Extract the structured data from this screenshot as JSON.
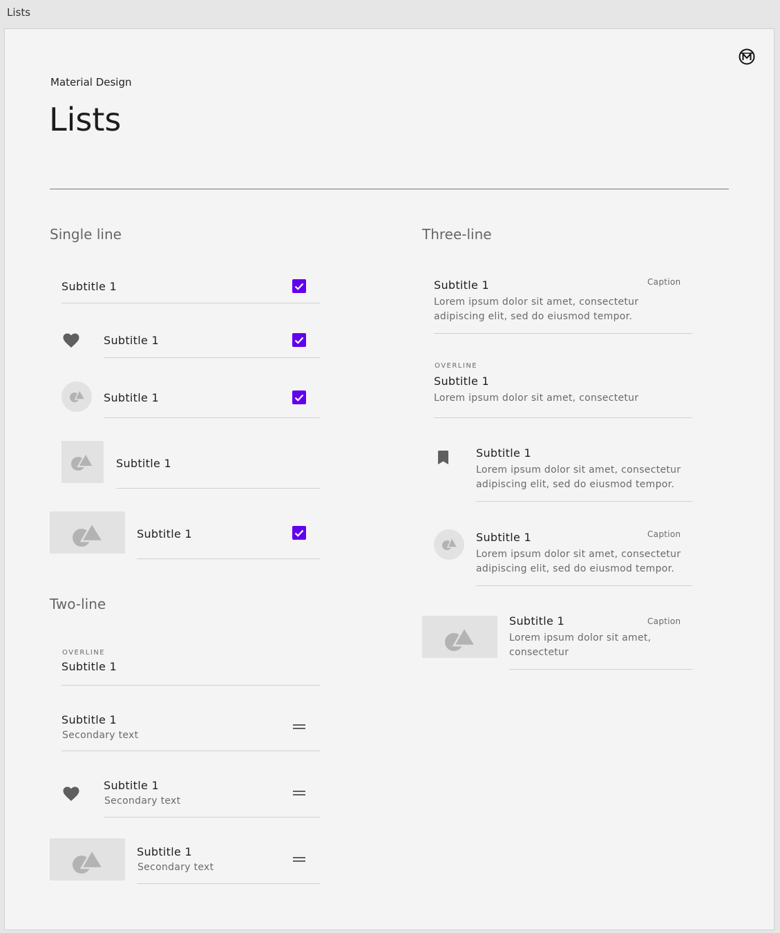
{
  "frame": {
    "title": "Lists"
  },
  "header": {
    "overline": "Material Design",
    "title": "Lists"
  },
  "colors": {
    "accent": "#6200ee",
    "icon": "#5f5f5f",
    "placeholder": "#e2e2e2",
    "placeholder_shape": "#b3b3b3"
  },
  "single_line": {
    "heading": "Single line",
    "items": [
      {
        "subtitle": "Subtitle 1",
        "checked": true
      },
      {
        "subtitle": "Subtitle 1",
        "leading": "heart-icon",
        "checked": true
      },
      {
        "subtitle": "Subtitle 1",
        "leading": "avatar",
        "checked": true
      },
      {
        "subtitle": "Subtitle 1",
        "leading": "square-thumbnail"
      },
      {
        "subtitle": "Subtitle 1",
        "leading": "wide-thumbnail",
        "checked": true
      }
    ]
  },
  "two_line": {
    "heading": "Two-line",
    "items": [
      {
        "overline": "OVERLINE",
        "subtitle": "Subtitle 1"
      },
      {
        "subtitle": "Subtitle 1",
        "secondary": "Secondary text",
        "trailing": "drag-handle-icon"
      },
      {
        "subtitle": "Subtitle 1",
        "secondary": "Secondary text",
        "leading": "heart-icon",
        "trailing": "drag-handle-icon"
      },
      {
        "subtitle": "Subtitle 1",
        "secondary": "Secondary text",
        "leading": "wide-thumbnail",
        "trailing": "drag-handle-icon"
      }
    ]
  },
  "three_line": {
    "heading": "Three-line",
    "items": [
      {
        "subtitle": "Subtitle 1",
        "caption": "Caption",
        "body": "Lorem ipsum dolor sit amet, consectetur adipiscing elit, sed do eiusmod tempor."
      },
      {
        "overline": "OVERLINE",
        "subtitle": "Subtitle 1",
        "body": "Lorem ipsum dolor sit amet, consectetur"
      },
      {
        "subtitle": "Subtitle 1",
        "leading": "bookmark-icon",
        "body": "Lorem ipsum dolor sit amet, consectetur adipiscing elit, sed do eiusmod tempor."
      },
      {
        "subtitle": "Subtitle 1",
        "leading": "avatar",
        "caption": "Caption",
        "body": "Lorem ipsum dolor sit amet, consectetur adipiscing elit, sed do eiusmod tempor."
      },
      {
        "subtitle": "Subtitle 1",
        "leading": "wide-thumbnail",
        "caption": "Caption",
        "body": "Lorem ipsum dolor sit amet, consectetur"
      }
    ]
  }
}
